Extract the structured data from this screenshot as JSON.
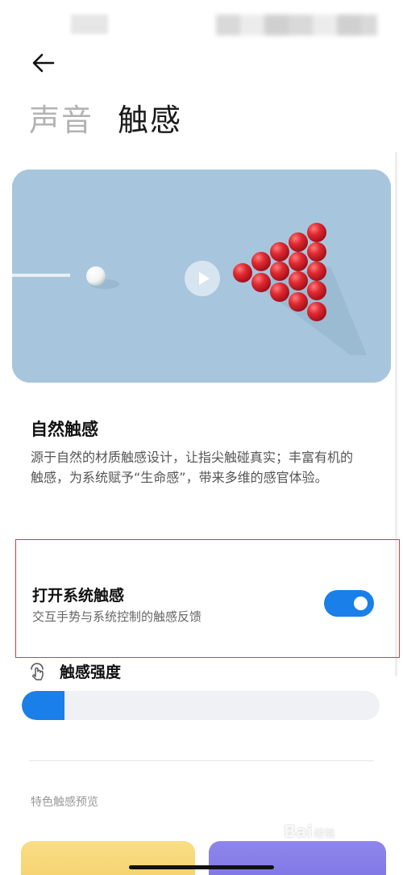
{
  "header": {
    "tabs": [
      {
        "label": "声音",
        "active": false
      },
      {
        "label": "触感",
        "active": true
      }
    ]
  },
  "icons": {
    "back": "arrow-left-icon",
    "play": "play-icon",
    "strength": "touch-icon"
  },
  "feature": {
    "title": "自然触感",
    "description": "源于自然的材质触感设计，让指尖触碰真实；丰富有机的触感，为系统赋予“生命感”，带来多维的感官体验。"
  },
  "system_haptics": {
    "title": "打开系统触感",
    "description": "交互手势与系统控制的触感反馈",
    "enabled": true
  },
  "strength": {
    "label": "触感强度",
    "level_fraction": 0.12
  },
  "preview": {
    "label": "特色触感预览"
  },
  "watermark": {
    "brand": "Bai",
    "suffix": "经验"
  },
  "colors": {
    "accent": "#1a7fe8",
    "highlight_border": "#d83b3b",
    "card_yellow": "#f6d474",
    "card_purple": "#857bea"
  }
}
